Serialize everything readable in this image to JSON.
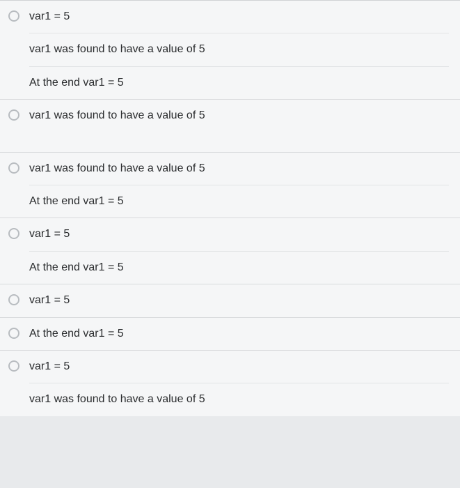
{
  "options": [
    {
      "lines": [
        "var1 = 5",
        "var1 was found to have a value of 5",
        "At the end var1 = 5"
      ]
    },
    {
      "lines": [
        "var1 was found to have a value of 5"
      ]
    },
    {
      "lines": [
        "var1 was found to have a value of 5",
        "At the end var1 = 5"
      ]
    },
    {
      "lines": [
        "var1 = 5",
        "At the end var1 = 5"
      ]
    },
    {
      "lines": [
        "var1 = 5"
      ]
    },
    {
      "lines": [
        "At the end var1 = 5"
      ]
    },
    {
      "lines": [
        "var1 = 5",
        "var1 was found to have a value of 5"
      ]
    }
  ]
}
